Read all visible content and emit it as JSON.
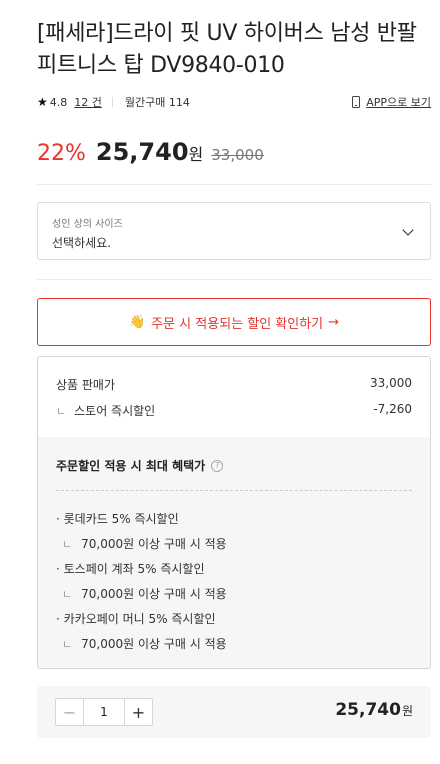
{
  "product": {
    "title": "[패세라]드라이 핏 UV 하이버스 남성 반팔 피트니스 탑 DV9840-010",
    "rating": "4.8",
    "review_count": "12 건",
    "monthly_purchases": "월간구매 114",
    "app_link": "APP으로 보기"
  },
  "pricing": {
    "discount": "22%",
    "price": "25,740",
    "unit": "원",
    "original": "33,000"
  },
  "option": {
    "label": "성인 상의 사이즈",
    "placeholder": "선택하세요."
  },
  "promo_button": {
    "label": "주문 시 적용되는 할인 확인하기",
    "arrow": "→"
  },
  "benefit": {
    "sale_price_label": "상품 판매가",
    "sale_price_value": "33,000",
    "store_discount_label": "스토어 즉시할인",
    "store_discount_value": "-7,260",
    "max_title": "주문할인 적용 시 최대 혜택가",
    "items": [
      {
        "title": "· 롯데카드 5% 즉시할인",
        "condition": "70,000원 이상 구매 시 적용"
      },
      {
        "title": "· 토스페이 계좌 5% 즉시할인",
        "condition": "70,000원 이상 구매 시 적용"
      },
      {
        "title": "· 카카오페이 머니 5% 즉시할인",
        "condition": "70,000원 이상 구매 시 적용"
      }
    ]
  },
  "quantity": {
    "value": "1",
    "total": "25,740",
    "unit": "원"
  },
  "icons": {
    "star": "star-icon",
    "phone": "phone-icon",
    "chevron": "chevron-down-icon",
    "hand": "hand-icon",
    "help": "help-circle-icon",
    "corner": "sub-item-corner-icon"
  },
  "colors": {
    "accent": "#e5342c",
    "panel_bg": "#f6f6f6"
  }
}
